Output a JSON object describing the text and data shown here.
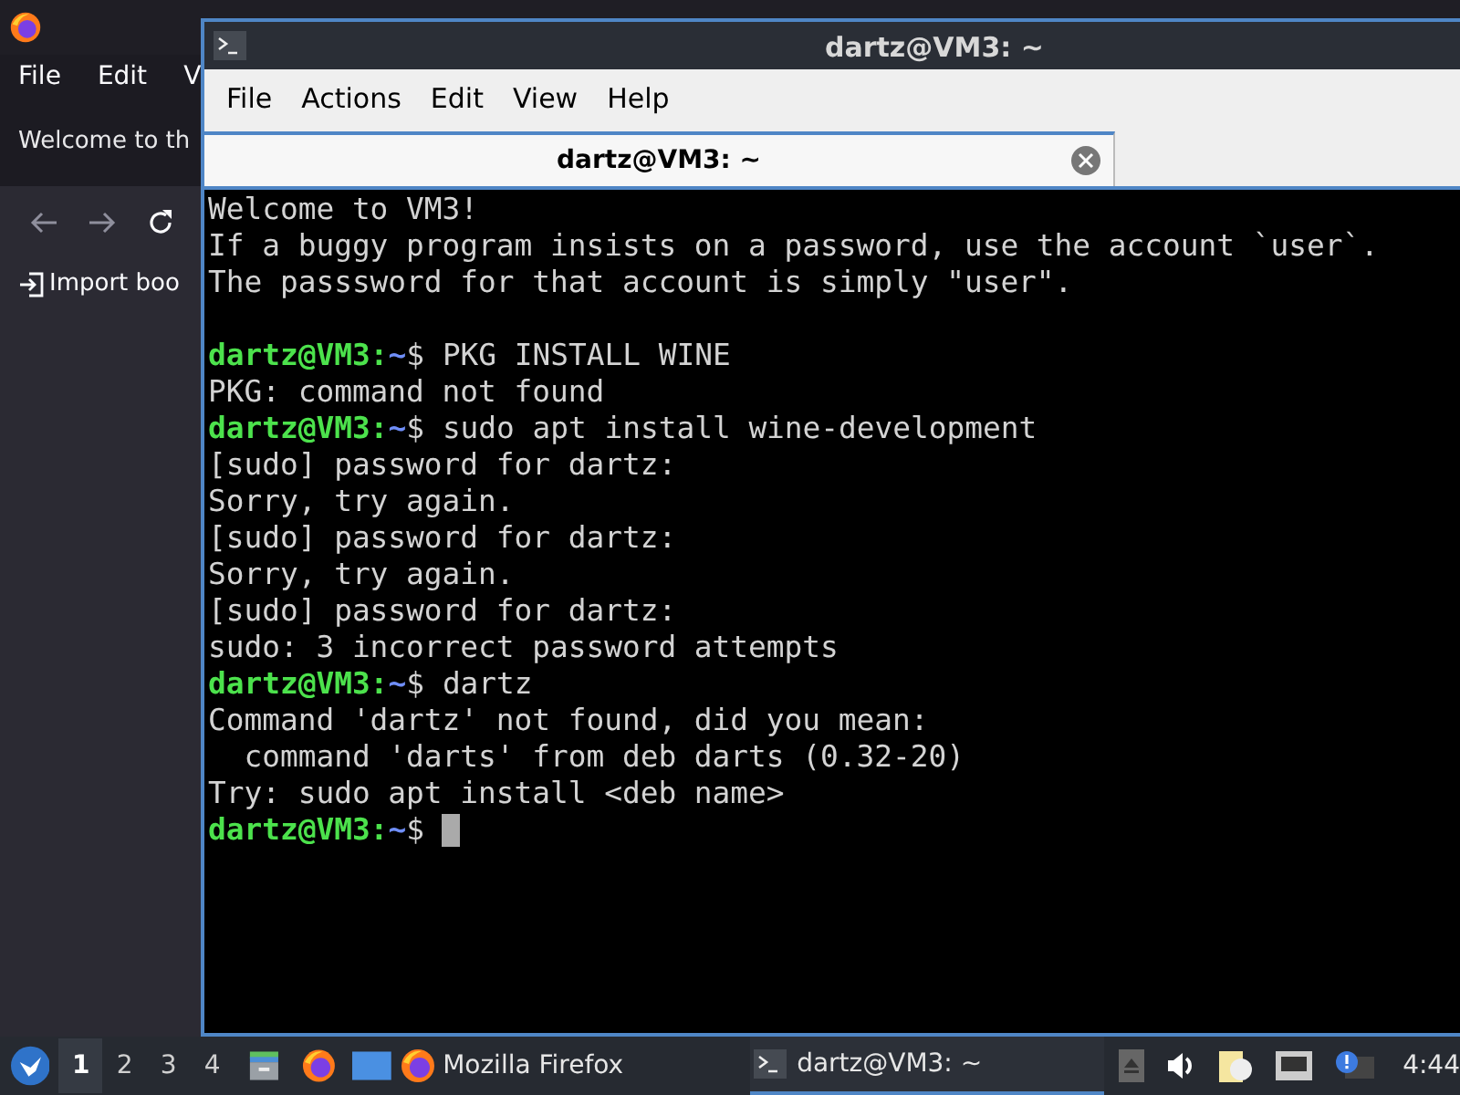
{
  "background_window": {
    "menu": [
      "File",
      "Edit",
      "V"
    ],
    "banner": "Welcome to th",
    "bookmark": "Import boo"
  },
  "terminal": {
    "title": "dartz@VM3: ~",
    "menu": [
      "File",
      "Actions",
      "Edit",
      "View",
      "Help"
    ],
    "tabs": [
      {
        "label": "dartz@VM3: ~",
        "selected": true
      }
    ],
    "lines": [
      {
        "kind": "output",
        "text": "Welcome to VM3!"
      },
      {
        "kind": "output",
        "text": "If a buggy program insists on a password, use the account `user`."
      },
      {
        "kind": "output",
        "text": "The passsword for that account is simply \"user\"."
      },
      {
        "kind": "blank"
      },
      {
        "kind": "prompt",
        "user": "dartz@VM3:",
        "path": "~",
        "symbol": "$",
        "command": "PKG INSTALL WINE",
        "cursor": false
      },
      {
        "kind": "output",
        "text": "PKG: command not found"
      },
      {
        "kind": "prompt",
        "user": "dartz@VM3:",
        "path": "~",
        "symbol": "$",
        "command": "sudo apt install wine-development",
        "cursor": false
      },
      {
        "kind": "output",
        "text": "[sudo] password for dartz:"
      },
      {
        "kind": "output",
        "text": "Sorry, try again."
      },
      {
        "kind": "output",
        "text": "[sudo] password for dartz:"
      },
      {
        "kind": "output",
        "text": "Sorry, try again."
      },
      {
        "kind": "output",
        "text": "[sudo] password for dartz:"
      },
      {
        "kind": "output",
        "text": "sudo: 3 incorrect password attempts"
      },
      {
        "kind": "prompt",
        "user": "dartz@VM3:",
        "path": "~",
        "symbol": "$",
        "command": "dartz",
        "cursor": false
      },
      {
        "kind": "output",
        "text": "Command 'dartz' not found, did you mean:"
      },
      {
        "kind": "output",
        "text": "  command 'darts' from deb darts (0.32-20)"
      },
      {
        "kind": "output",
        "text": "Try: sudo apt install <deb name>"
      },
      {
        "kind": "prompt",
        "user": "dartz@VM3:",
        "path": "~",
        "symbol": "$",
        "cursor": true
      }
    ]
  },
  "taskbar": {
    "workspaces": [
      {
        "label": "1",
        "selected": true
      },
      {
        "label": "2",
        "selected": false
      },
      {
        "label": "3",
        "selected": false
      },
      {
        "label": "4",
        "selected": false
      }
    ],
    "tasks": [
      {
        "kind": "browser",
        "label": "Mozilla Firefox",
        "selected": false
      },
      {
        "kind": "terminal",
        "label": "dartz@VM3: ~",
        "selected": true
      }
    ],
    "clock": "4:44"
  }
}
